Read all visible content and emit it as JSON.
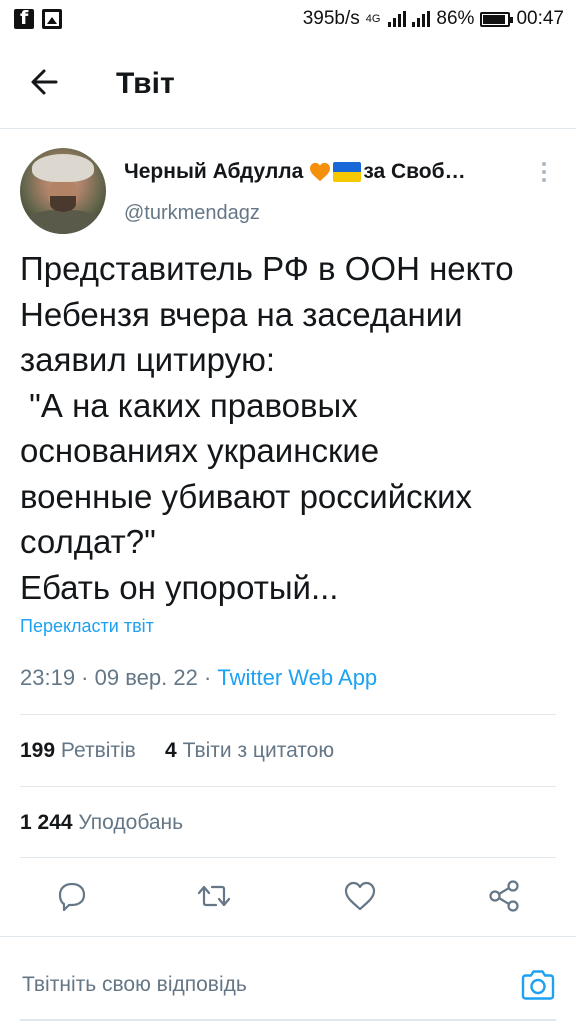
{
  "status_bar": {
    "speed": "395b/s",
    "network": "4G",
    "battery": "86%",
    "time": "00:47",
    "icons": [
      "facebook-icon",
      "image-icon",
      "signal-icon",
      "battery-icon"
    ]
  },
  "header": {
    "back_icon": "arrow-left-icon",
    "title": "Твіт"
  },
  "tweet": {
    "author_name": "Черный Абдулла",
    "author_name_suffix": "за Своб…",
    "heart_color": "#f4900c",
    "handle": "@turkmendagz",
    "text": "Представитель РФ в ООН некто\nНебензя вчера на заседании\nзаявил цитирую:\n \"А на каких правовых\nоснованиях украинские\nвоенные убивают российских\nсолдат?\"\nЕбать он упоротый...",
    "translate_label": "Перекласти твіт",
    "time": "23:19",
    "date": "09 вер. 22",
    "app": "Twitter Web App",
    "separator": " · "
  },
  "stats": {
    "retweets_count": "199",
    "retweets_label": "Ретвітів",
    "quotes_count": "4",
    "quotes_label": "Твіти з цитатою",
    "likes_count": "1 244",
    "likes_label": "Уподобань"
  },
  "actions": [
    "reply-icon",
    "retweet-icon",
    "like-icon",
    "share-icon"
  ],
  "reply": {
    "placeholder": "Твітніть свою відповідь",
    "camera_icon": "camera-icon"
  },
  "colors": {
    "accent": "#1da1f2",
    "text": "#14171a",
    "secondary": "#657786",
    "divider": "#e1e8ed"
  }
}
